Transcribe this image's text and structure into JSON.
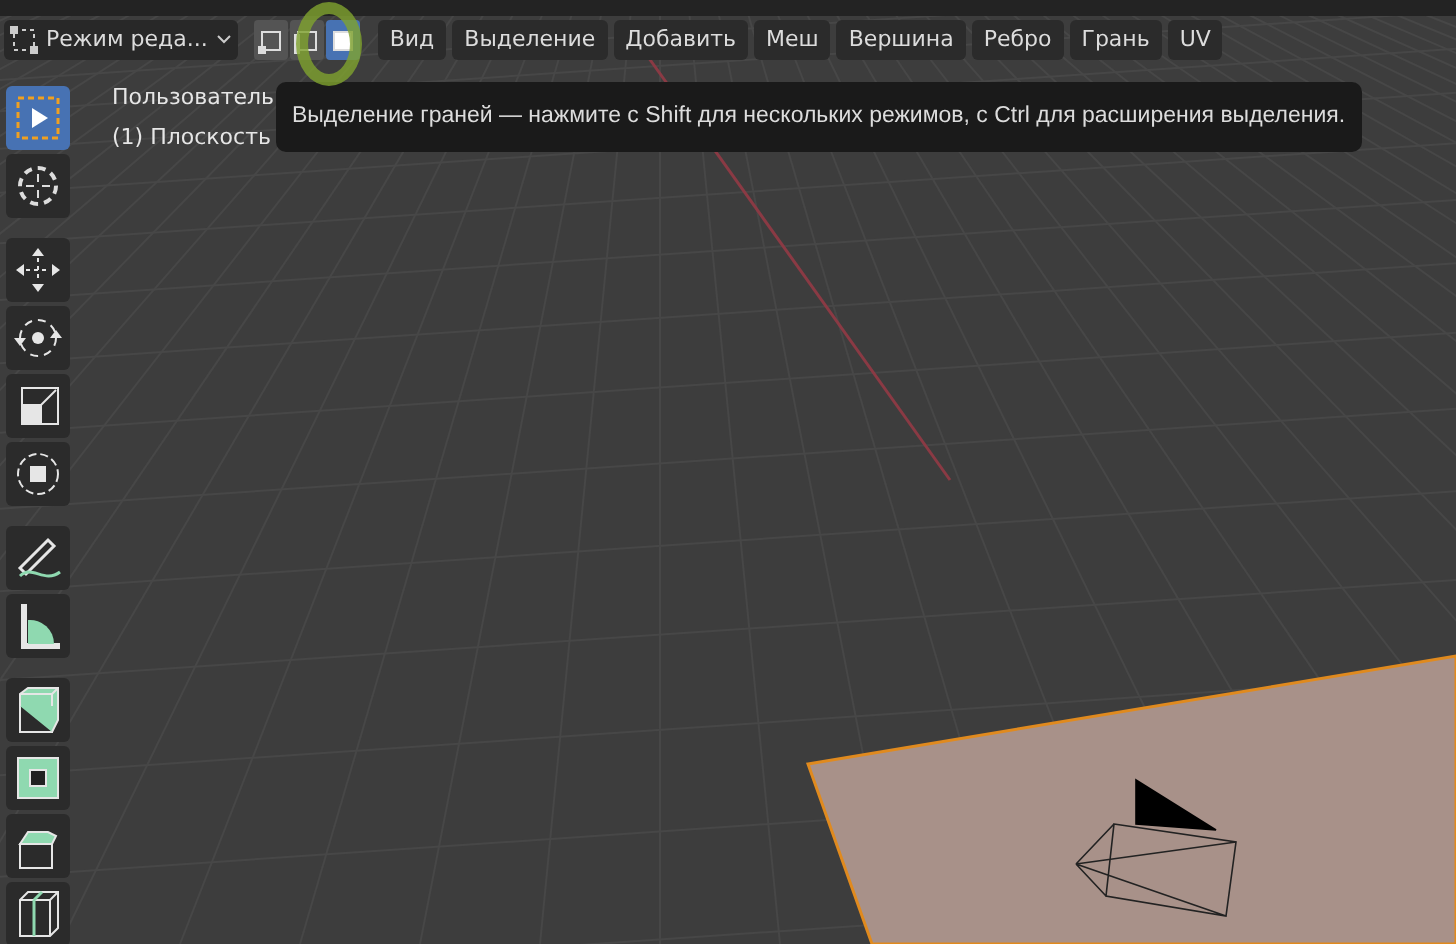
{
  "mode_selector": {
    "label": "Режим реда..."
  },
  "select_modes": [
    {
      "kind": "vertex",
      "selected": false
    },
    {
      "kind": "edge",
      "selected": false
    },
    {
      "kind": "face",
      "selected": true
    }
  ],
  "menu": [
    "Вид",
    "Выделение",
    "Добавить",
    "Меш",
    "Вершина",
    "Ребро",
    "Грань",
    "UV"
  ],
  "viewport": {
    "view_name": "Пользователь",
    "object_name": "(1) Плоскость"
  },
  "tooltip": "Выделение граней — нажмите с Shift для нескольких режимов, с Ctrl для расширения выделения.",
  "tools": [
    {
      "kind": "select",
      "selected": true
    },
    {
      "kind": "cursor",
      "selected": false
    },
    {
      "kind": "move",
      "selected": false
    },
    {
      "kind": "rotate",
      "selected": false
    },
    {
      "kind": "scale",
      "selected": false
    },
    {
      "kind": "transform",
      "selected": false
    },
    {
      "kind": "annotate",
      "selected": false
    },
    {
      "kind": "measure",
      "selected": false
    },
    {
      "kind": "extrude",
      "selected": false
    },
    {
      "kind": "inset",
      "selected": false
    },
    {
      "kind": "bevel",
      "selected": false
    },
    {
      "kind": "loopcut",
      "selected": false
    }
  ]
}
